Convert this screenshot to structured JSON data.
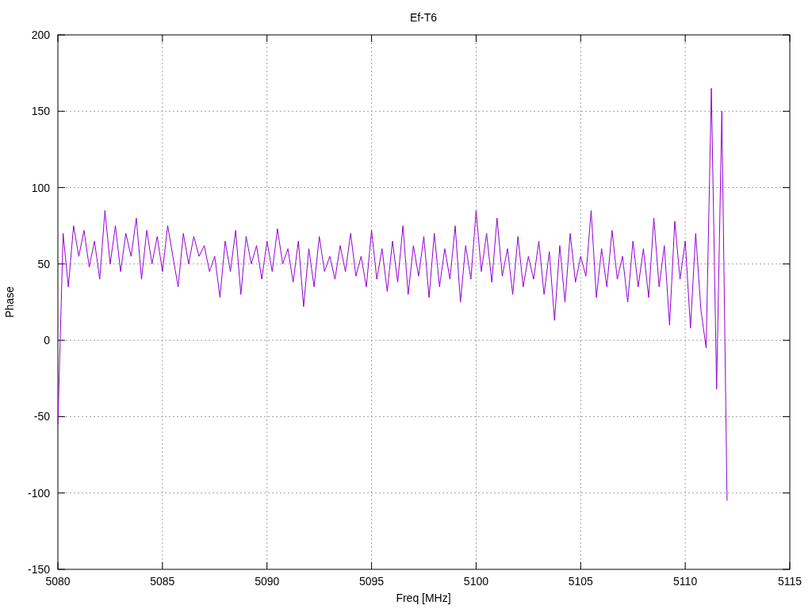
{
  "chart_data": {
    "type": "line",
    "title": "Ef-T6",
    "xlabel": "Freq [MHz]",
    "ylabel": "Phase",
    "xlim": [
      5080,
      5115
    ],
    "grid": true,
    "ylim": [
      -150,
      200
    ],
    "xticks": [
      5080,
      5085,
      5090,
      5095,
      5100,
      5105,
      5110,
      5115
    ],
    "yticks": [
      -150,
      -100,
      -50,
      0,
      50,
      100,
      150,
      200
    ],
    "x": [
      5080,
      5080.25,
      5080.5,
      5080.75,
      5081,
      5081.25,
      5081.5,
      5081.75,
      5082,
      5082.25,
      5082.5,
      5082.75,
      5083,
      5083.25,
      5083.5,
      5083.75,
      5084,
      5084.25,
      5084.5,
      5084.75,
      5085,
      5085.25,
      5085.5,
      5085.75,
      5086,
      5086.25,
      5086.5,
      5086.75,
      5087,
      5087.25,
      5087.5,
      5087.75,
      5088,
      5088.25,
      5088.5,
      5088.75,
      5089,
      5089.25,
      5089.5,
      5089.75,
      5090,
      5090.25,
      5090.5,
      5090.75,
      5091,
      5091.25,
      5091.5,
      5091.75,
      5092,
      5092.25,
      5092.5,
      5092.75,
      5093,
      5093.25,
      5093.5,
      5093.75,
      5094,
      5094.25,
      5094.5,
      5094.75,
      5095,
      5095.25,
      5095.5,
      5095.75,
      5096,
      5096.25,
      5096.5,
      5096.75,
      5097,
      5097.25,
      5097.5,
      5097.75,
      5098,
      5098.25,
      5098.5,
      5098.75,
      5099,
      5099.25,
      5099.5,
      5099.75,
      5100,
      5100.25,
      5100.5,
      5100.75,
      5101,
      5101.25,
      5101.5,
      5101.75,
      5102,
      5102.25,
      5102.5,
      5102.75,
      5103,
      5103.25,
      5103.5,
      5103.75,
      5104,
      5104.25,
      5104.5,
      5104.75,
      5105,
      5105.25,
      5105.5,
      5105.75,
      5106,
      5106.25,
      5106.5,
      5106.75,
      5107,
      5107.25,
      5107.5,
      5107.75,
      5108,
      5108.25,
      5108.5,
      5108.75,
      5109,
      5109.25,
      5109.5,
      5109.75,
      5110,
      5110.25,
      5110.5,
      5110.75,
      5111,
      5111.25,
      5111.5,
      5111.75,
      5112
    ],
    "series": [
      {
        "color": "#9400d3",
        "values": [
          -55,
          70,
          35,
          75,
          55,
          72,
          48,
          65,
          40,
          85,
          50,
          75,
          45,
          70,
          55,
          80,
          40,
          72,
          50,
          68,
          45,
          75,
          55,
          35,
          70,
          50,
          68,
          55,
          62,
          45,
          55,
          28,
          65,
          45,
          72,
          30,
          68,
          50,
          62,
          40,
          65,
          45,
          73,
          50,
          60,
          38,
          65,
          22,
          60,
          35,
          68,
          45,
          55,
          40,
          62,
          45,
          70,
          42,
          55,
          35,
          72,
          40,
          60,
          32,
          65,
          38,
          75,
          30,
          62,
          42,
          68,
          28,
          70,
          35,
          60,
          40,
          75,
          25,
          62,
          40,
          85,
          45,
          70,
          38,
          80,
          42,
          60,
          30,
          68,
          35,
          55,
          40,
          65,
          30,
          58,
          13,
          62,
          25,
          70,
          38,
          55,
          42,
          85,
          28,
          60,
          35,
          72,
          40,
          55,
          25,
          65,
          35,
          60,
          28,
          80,
          35,
          62,
          10,
          78,
          40,
          65,
          8,
          70,
          20,
          -5,
          165,
          -32,
          150,
          -105
        ]
      }
    ]
  }
}
